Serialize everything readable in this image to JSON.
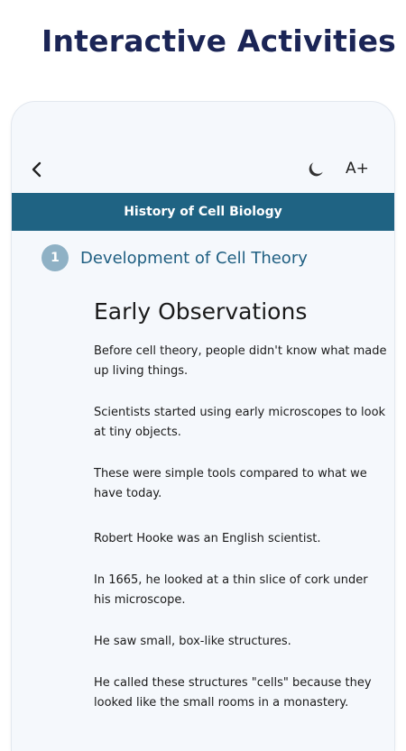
{
  "headline": "Interactive Activities",
  "toolbar": {
    "back_icon": "chevron-left-icon",
    "theme_icon": "moon-icon",
    "font_size_label": "A+"
  },
  "title_bar": {
    "title": "History of Cell Biology",
    "color": "#1f6383"
  },
  "section": {
    "number": "1",
    "title": "Development of Cell Theory",
    "badge_color": "#8fb1c5",
    "title_color": "#1f5f82"
  },
  "content": {
    "heading": "Early Observations",
    "paragraphs": [
      "Before cell theory, people didn't know what made up living things.",
      "Scientists started using early microscopes to look at tiny objects.",
      "These were simple tools compared to what we have today.",
      "Robert Hooke was an English scientist.",
      "In 1665, he looked at a thin slice of cork under his microscope.",
      "He saw small, box-like structures.",
      "He called these structures \"cells\" because they looked like the small rooms in a monastery."
    ]
  }
}
